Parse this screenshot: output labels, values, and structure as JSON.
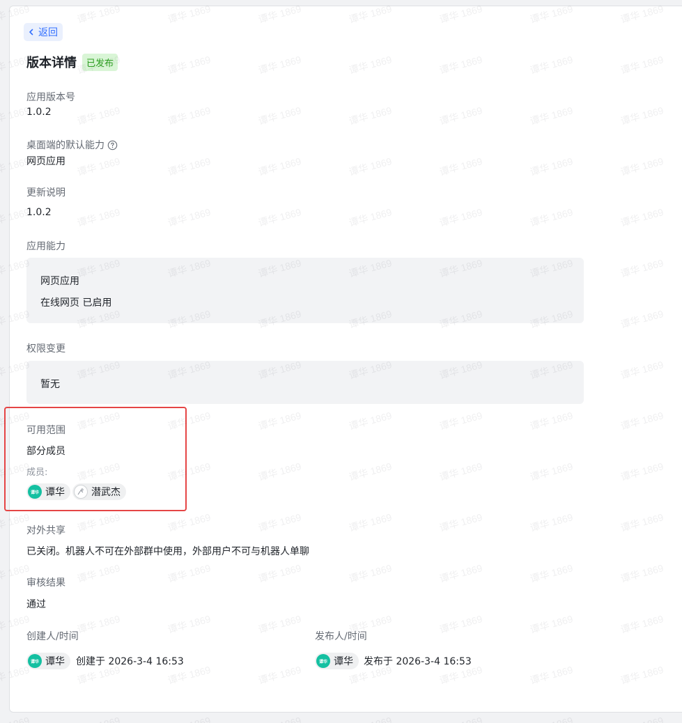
{
  "nav": {
    "back_label": "返回"
  },
  "header": {
    "title": "版本详情",
    "status_badge": "已发布"
  },
  "app_version": {
    "label": "应用版本号",
    "value": "1.0.2"
  },
  "default_capability": {
    "label": "桌面端的默认能力",
    "value": "网页应用"
  },
  "release_notes": {
    "label": "更新说明",
    "value": "1.0.2"
  },
  "capabilities": {
    "label": "应用能力",
    "items": [
      {
        "title": "网页应用",
        "detail": "在线网页 已启用"
      }
    ]
  },
  "permission_changes": {
    "label": "权限变更",
    "value": "暂无"
  },
  "availability": {
    "label": "可用范围",
    "value": "部分成员",
    "members_label": "成员:",
    "members": [
      {
        "name": "谭华",
        "avatar_text": "谭华"
      },
      {
        "name": "潜武杰",
        "avatar_text": ""
      }
    ]
  },
  "external_sharing": {
    "label": "对外共享",
    "value": "已关闭。机器人不可在外部群中使用，外部用户不可与机器人单聊"
  },
  "review": {
    "label": "审核结果",
    "value": "通过"
  },
  "creator": {
    "label": "创建人/时间",
    "name": "谭华",
    "avatar_text": "谭华",
    "time_text": "创建于 2026-3-4 16:53"
  },
  "publisher": {
    "label": "发布人/时间",
    "name": "谭华",
    "avatar_text": "谭华",
    "time_text": "发布于 2026-3-4 16:53"
  },
  "watermark": {
    "text": "谭华 1869"
  },
  "colors": {
    "accent": "#3370ff",
    "success_bg": "#d9f5d6",
    "success_text": "#2ea121",
    "highlight_border": "#e54545",
    "avatar_green": "#14c0a1"
  }
}
